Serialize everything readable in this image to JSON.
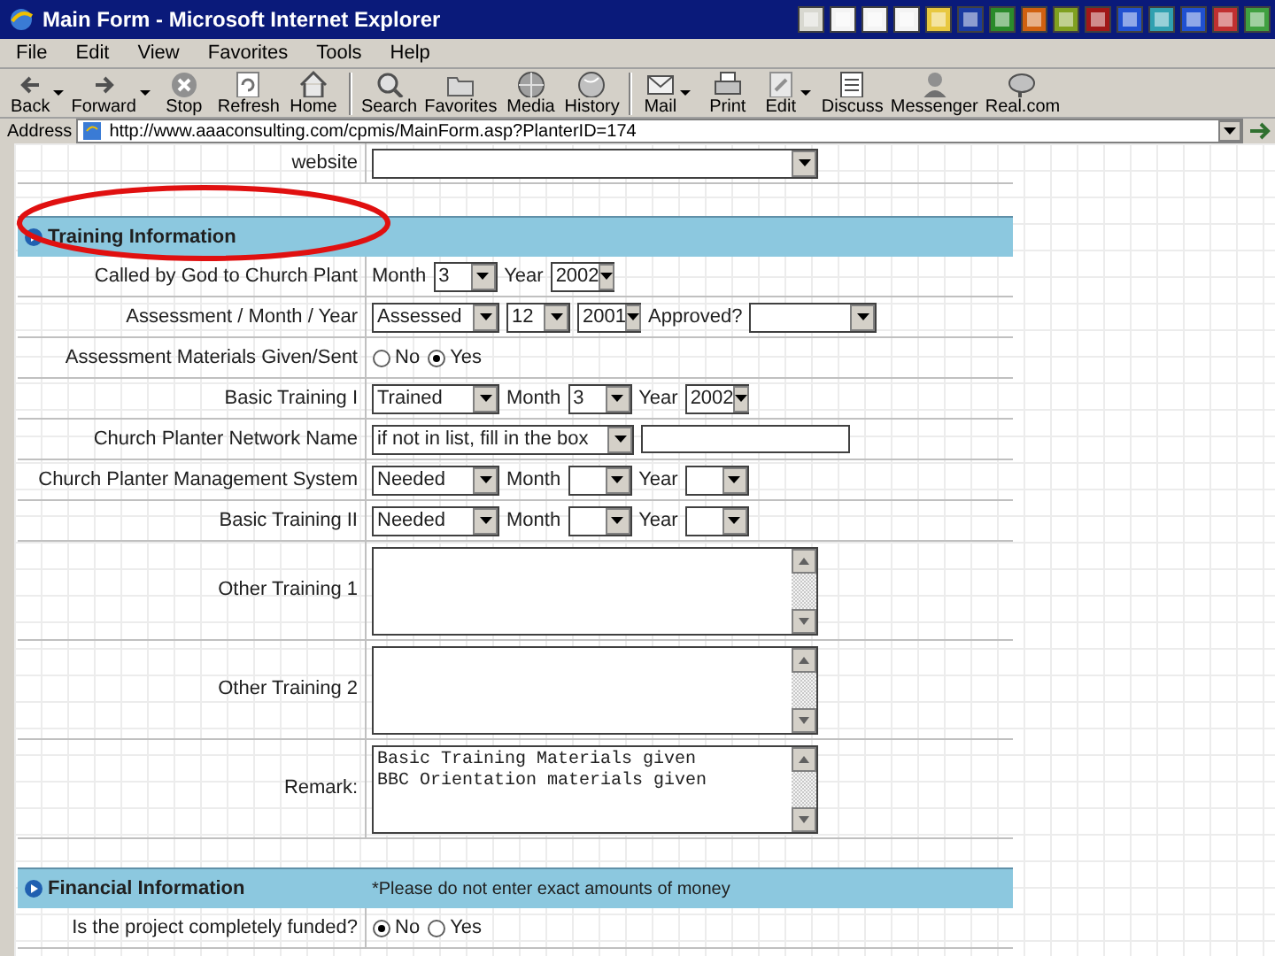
{
  "window": {
    "title": "Main Form - Microsoft Internet Explorer"
  },
  "menu": [
    "File",
    "Edit",
    "View",
    "Favorites",
    "Tools",
    "Help"
  ],
  "toolbar": [
    [
      {
        "label": "Back",
        "dropdown": true
      },
      {
        "label": "Forward",
        "dropdown": true
      },
      {
        "label": "Stop",
        "dropdown": false
      },
      {
        "label": "Refresh",
        "dropdown": false
      },
      {
        "label": "Home",
        "dropdown": false
      }
    ],
    [
      {
        "label": "Search",
        "dropdown": false
      },
      {
        "label": "Favorites",
        "dropdown": false
      },
      {
        "label": "Media",
        "dropdown": false
      },
      {
        "label": "History",
        "dropdown": false
      }
    ],
    [
      {
        "label": "Mail",
        "dropdown": true
      },
      {
        "label": "Print",
        "dropdown": false
      },
      {
        "label": "Edit",
        "dropdown": true
      },
      {
        "label": "Discuss",
        "dropdown": false
      },
      {
        "label": "Messenger",
        "dropdown": false
      },
      {
        "label": "Real.com",
        "dropdown": false
      }
    ]
  ],
  "address": {
    "label": "Address",
    "url": "http://www.aaaconsulting.com/cpmis/MainForm.asp?PlanterID=174"
  },
  "form": [
    {
      "kind": "row",
      "label": "website",
      "controls": [
        {
          "kind": "select-long"
        }
      ]
    },
    {
      "kind": "section",
      "title": "Training Information"
    },
    {
      "kind": "row",
      "label": "Called by God to Church Plant",
      "controls": [
        {
          "kind": "text",
          "value": "Month"
        },
        {
          "kind": "select-small",
          "value": "3"
        },
        {
          "kind": "text",
          "value": "Year"
        },
        {
          "kind": "select-small",
          "value": "2002"
        }
      ]
    },
    {
      "kind": "row",
      "label": "Assessment / Month / Year",
      "controls": [
        {
          "kind": "select",
          "value": "Assessed"
        },
        {
          "kind": "select-small",
          "value": "12"
        },
        {
          "kind": "select-small",
          "value": "2001"
        },
        {
          "kind": "text",
          "value": "Approved?"
        },
        {
          "kind": "select"
        }
      ]
    },
    {
      "kind": "row",
      "label": "Assessment Materials Given/Sent",
      "controls": [
        {
          "kind": "radio",
          "options": [
            {
              "label": "No",
              "selected": false
            },
            {
              "label": "Yes",
              "selected": true
            }
          ]
        }
      ]
    },
    {
      "kind": "row",
      "label": "Basic Training I",
      "controls": [
        {
          "kind": "select",
          "value": "Trained"
        },
        {
          "kind": "text",
          "value": "Month"
        },
        {
          "kind": "select-small",
          "value": "3"
        },
        {
          "kind": "text",
          "value": "Year"
        },
        {
          "kind": "select-small",
          "value": "2002"
        }
      ]
    },
    {
      "kind": "row",
      "label": "Church Planter Network Name",
      "controls": [
        {
          "kind": "select-wide",
          "value": "if not in list, fill in the box"
        },
        {
          "kind": "input"
        }
      ]
    },
    {
      "kind": "row",
      "label": "Church Planter Management System",
      "controls": [
        {
          "kind": "select",
          "value": "Needed"
        },
        {
          "kind": "text",
          "value": "Month"
        },
        {
          "kind": "select-small"
        },
        {
          "kind": "text",
          "value": "Year"
        },
        {
          "kind": "select-small"
        }
      ]
    },
    {
      "kind": "row",
      "label": "Basic Training II",
      "controls": [
        {
          "kind": "select",
          "value": "Needed"
        },
        {
          "kind": "text",
          "value": "Month"
        },
        {
          "kind": "select-small"
        },
        {
          "kind": "text",
          "value": "Year"
        },
        {
          "kind": "select-small"
        }
      ]
    },
    {
      "kind": "area",
      "label": "Other Training 1"
    },
    {
      "kind": "area",
      "label": "Other Training 2"
    },
    {
      "kind": "area",
      "label": "Remark:",
      "value": "Basic Training Materials given\nBBC Orientation materials given"
    },
    {
      "kind": "gap"
    },
    {
      "kind": "section",
      "title": "Financial Information",
      "note": "*Please do not enter exact amounts of money"
    },
    {
      "kind": "row",
      "label": "Is the project completely funded?",
      "controls": [
        {
          "kind": "radio",
          "options": [
            {
              "label": "No",
              "selected": true
            },
            {
              "label": "Yes",
              "selected": false
            }
          ]
        }
      ]
    }
  ]
}
